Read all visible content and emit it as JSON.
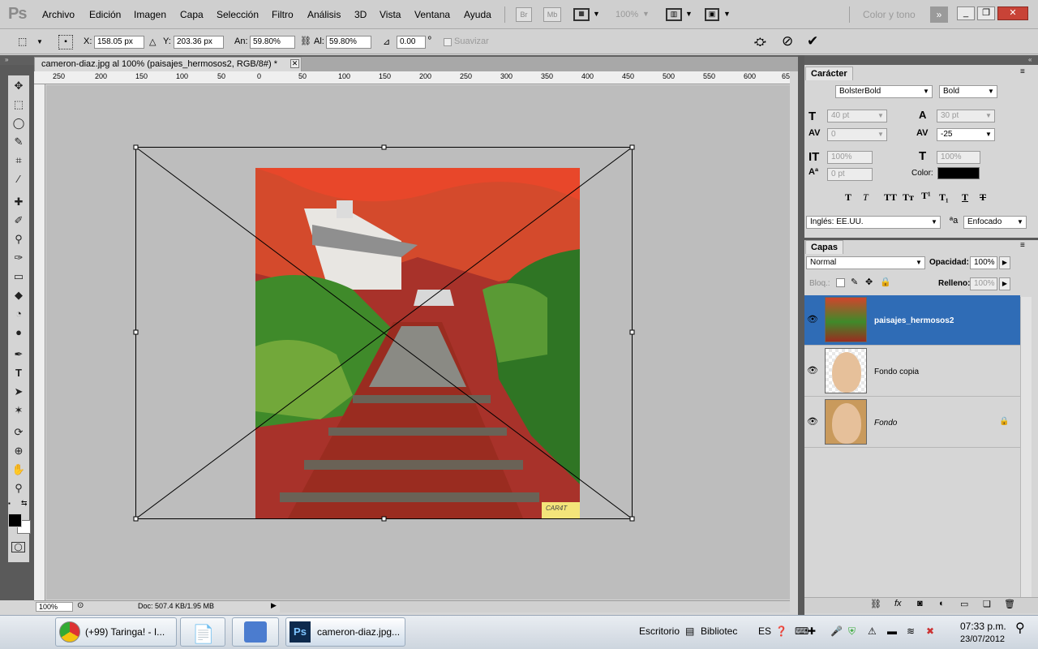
{
  "menubar": {
    "logo": "Ps",
    "items": [
      "Archivo",
      "Edición",
      "Imagen",
      "Capa",
      "Selección",
      "Filtro",
      "Análisis",
      "3D",
      "Vista",
      "Ventana",
      "Ayuda"
    ],
    "zoom": "100%",
    "br_label": "Br",
    "mb_label": "Mb",
    "workspace": "Color y tono"
  },
  "options": {
    "x_label": "X:",
    "x_value": "158.05 px",
    "y_label": "Y:",
    "y_value": "203.36 px",
    "w_label": "An:",
    "w_value": "59.80%",
    "h_label": "Al:",
    "h_value": "59.80%",
    "angle_value": "0.00",
    "degree": "º",
    "smooth_label": "Suavizar"
  },
  "document": {
    "tab_title": "cameron-diaz.jpg al 100% (paisajes_hermosos2, RGB/8#) *",
    "ruler_labels": [
      "250",
      "200",
      "150",
      "100",
      "50",
      "0",
      "50",
      "100",
      "150",
      "200",
      "250",
      "300",
      "350",
      "400",
      "450",
      "500",
      "550",
      "600",
      "65"
    ],
    "watermark": "CAR4T"
  },
  "status": {
    "zoom": "100%",
    "doc_info": "Doc: 507.4 KB/1.95 MB"
  },
  "character": {
    "tab": "Carácter",
    "font": "BolsterBold",
    "style": "Bold",
    "size": "40 pt",
    "leading": "30 pt",
    "kerning": "0",
    "tracking": "-25",
    "vscale": "100%",
    "hscale": "100%",
    "baseline": "0 pt",
    "color_label": "Color:",
    "color": "#000000",
    "language": "Inglés: EE.UU.",
    "antialias_label": "ªa",
    "antialias": "Enfocado"
  },
  "layers": {
    "tab": "Capas",
    "blend": "Normal",
    "opacity_label": "Opacidad:",
    "opacity": "100%",
    "lock_label": "Bloq.:",
    "fill_label": "Relleno:",
    "fill": "100%",
    "items": [
      {
        "name": "paisajes_hermosos2",
        "selected": true
      },
      {
        "name": "Fondo copia",
        "selected": false
      },
      {
        "name": "Fondo",
        "selected": false
      }
    ]
  },
  "taskbar": {
    "tasks": [
      "(+99) Taringa! - I...",
      "cameron-diaz.jpg..."
    ],
    "desktop": "Escritorio",
    "library": "Bibliotec",
    "lang": "ES",
    "time": "07:33 p.m.",
    "date": "23/07/2012"
  },
  "colors": {
    "selection": "#2f6cb6",
    "canvas": "#bdbdbd",
    "close": "#c84337"
  }
}
